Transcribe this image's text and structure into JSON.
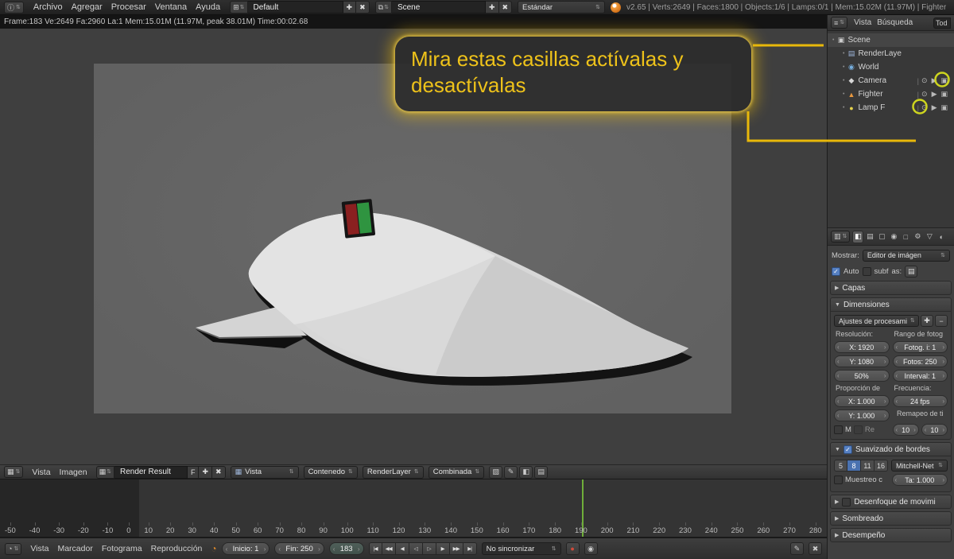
{
  "topbar": {
    "menus": [
      "Archivo",
      "Agregar",
      "Procesar",
      "Ventana",
      "Ayuda"
    ],
    "screen_selector": "Default",
    "scene_selector": "Scene",
    "engine_selector": "Estándar",
    "stats": "v2.65 | Verts:2649 | Faces:1800 | Objects:1/6 | Lamps:0/1 | Mem:15.02M (11.97M) | Fighter"
  },
  "infobar": {
    "text": "Frame:183 Ve:2649 Fa:2960 La:1 Mem:15.01M (11.97M, peak 38.01M) Time:00:02.68"
  },
  "callout": {
    "text": "Mira estas casillas actívalas y desactívalas",
    "color": "#eec21a"
  },
  "outliner": {
    "menus": [
      "Vista",
      "Búsqueda"
    ],
    "filter_tab": "Tod",
    "restrict_glyphs": {
      "eye": "⊙",
      "select": "▶",
      "render": "▣"
    },
    "items": [
      {
        "label": "Scene",
        "icon": "scene-icon",
        "glyph": "▣",
        "color": "#cccccc",
        "indent": 0,
        "restrict": false,
        "selected": true
      },
      {
        "label": "RenderLaye",
        "icon": "renderlayer-icon",
        "glyph": "▤",
        "color": "#9db4d8",
        "indent": 1,
        "restrict": false,
        "selected": false
      },
      {
        "label": "World",
        "icon": "world-icon",
        "glyph": "◉",
        "color": "#76aede",
        "indent": 1,
        "restrict": false,
        "selected": false
      },
      {
        "label": "Camera",
        "icon": "camera-icon",
        "glyph": "◆",
        "color": "#d8d8d8",
        "indent": 1,
        "restrict": true,
        "selected": false
      },
      {
        "label": "Fighter",
        "icon": "mesh-icon",
        "glyph": "▲",
        "color": "#e8983f",
        "indent": 1,
        "restrict": true,
        "selected": false
      },
      {
        "label": "Lamp F",
        "icon": "lamp-icon",
        "glyph": "●",
        "color": "#e6d34c",
        "indent": 1,
        "restrict": true,
        "selected": false
      }
    ]
  },
  "properties": {
    "tabs": [
      {
        "name": "render-tab-icon",
        "glyph": "◧",
        "active": true
      },
      {
        "name": "render-layers-tab-icon",
        "glyph": "▤",
        "active": false
      },
      {
        "name": "scene-tab-icon",
        "glyph": "▢",
        "active": false
      },
      {
        "name": "world-tab-icon",
        "glyph": "◉",
        "active": false
      },
      {
        "name": "object-tab-icon",
        "glyph": "□",
        "active": false
      },
      {
        "name": "constraints-tab-icon",
        "glyph": "⚙",
        "active": false
      },
      {
        "name": "data-tab-icon",
        "glyph": "▽",
        "active": false
      },
      {
        "name": "material-tab-icon",
        "glyph": "◐",
        "active": false
      }
    ],
    "mostrar_label": "Mostrar:",
    "mostrar_value": "Editor de imágen",
    "auto_label": "Auto",
    "subf_label": "subf",
    "as_label": "as:",
    "panel_capas": "Capas",
    "panel_dimensiones": "Dimensiones",
    "panel_suavizado": "Suavizado de bordes",
    "panel_desenfoque": "Desenfoque de movimi",
    "panel_sombreado": "Sombreado",
    "panel_desempeno": "Desempeño",
    "dim": {
      "preset": "Ajustes de procesami",
      "resolucion_label": "Resolución:",
      "rango_label": "Rango de fotog",
      "res_x": "X: 1920",
      "res_y": "Y: 1080",
      "res_pct": "50%",
      "fotog_i": "Fotog. i: 1",
      "fotos": "Fotos: 250",
      "interval": "Interval: 1",
      "proporcion_label": "Proporción de",
      "frecuencia_label": "Frecuencia:",
      "asp_x": "X: 1.000",
      "asp_y": "Y: 1.000",
      "fps": "24 fps",
      "remapeo_label": "Remapeo de ti",
      "m_label": "M",
      "re_label": "Re",
      "map_old": "10",
      "map_new": "10"
    },
    "aa": {
      "samples": [
        "5",
        "8",
        "11",
        "16"
      ],
      "selected": "8",
      "filter": "Mitchell-Net",
      "muestreo_label": "Muestreo c",
      "ta_value": "Ta: 1.000"
    }
  },
  "image_editor": {
    "menus": [
      "Vista",
      "Imagen"
    ],
    "datablock": "Render Result",
    "fake_user": "F",
    "vista_value": "Vista",
    "contenedor": "Contenedo",
    "layer": "RenderLayer",
    "pass": "Combinada",
    "icons": [
      {
        "name": "checker-alpha-icon",
        "glyph": "▨"
      },
      {
        "name": "paint-icon",
        "glyph": "✎"
      },
      {
        "name": "clip-icon",
        "glyph": "◧"
      },
      {
        "name": "scopes-icon",
        "glyph": "▤"
      }
    ]
  },
  "timeline": {
    "ticks": [
      "-50",
      "-40",
      "-30",
      "-20",
      "-10",
      "0",
      "10",
      "20",
      "30",
      "40",
      "50",
      "60",
      "70",
      "80",
      "90",
      "100",
      "110",
      "120",
      "130",
      "140",
      "150",
      "160",
      "170",
      "180",
      "190",
      "200",
      "210",
      "220",
      "230",
      "240",
      "250",
      "260",
      "270",
      "280"
    ],
    "range_start": -50,
    "range_end": 280,
    "current_frame": 183,
    "menus": [
      "Vista",
      "Marcador",
      "Fotograma",
      "Reproducción"
    ],
    "inicio": "Inicio: 1",
    "fin": "Fin: 250",
    "frame": "183",
    "sync": "No sincronizar",
    "playback": [
      {
        "name": "jump-start-button",
        "glyph": "|◀"
      },
      {
        "name": "prev-keyframe-button",
        "glyph": "◀◀"
      },
      {
        "name": "play-reverse-button",
        "glyph": "◀"
      },
      {
        "name": "prev-frame-button",
        "glyph": "◁"
      },
      {
        "name": "next-frame-button",
        "glyph": "▷"
      },
      {
        "name": "play-button",
        "glyph": "▶"
      },
      {
        "name": "next-keyframe-button",
        "glyph": "▶▶"
      },
      {
        "name": "jump-end-button",
        "glyph": "▶|"
      }
    ]
  }
}
